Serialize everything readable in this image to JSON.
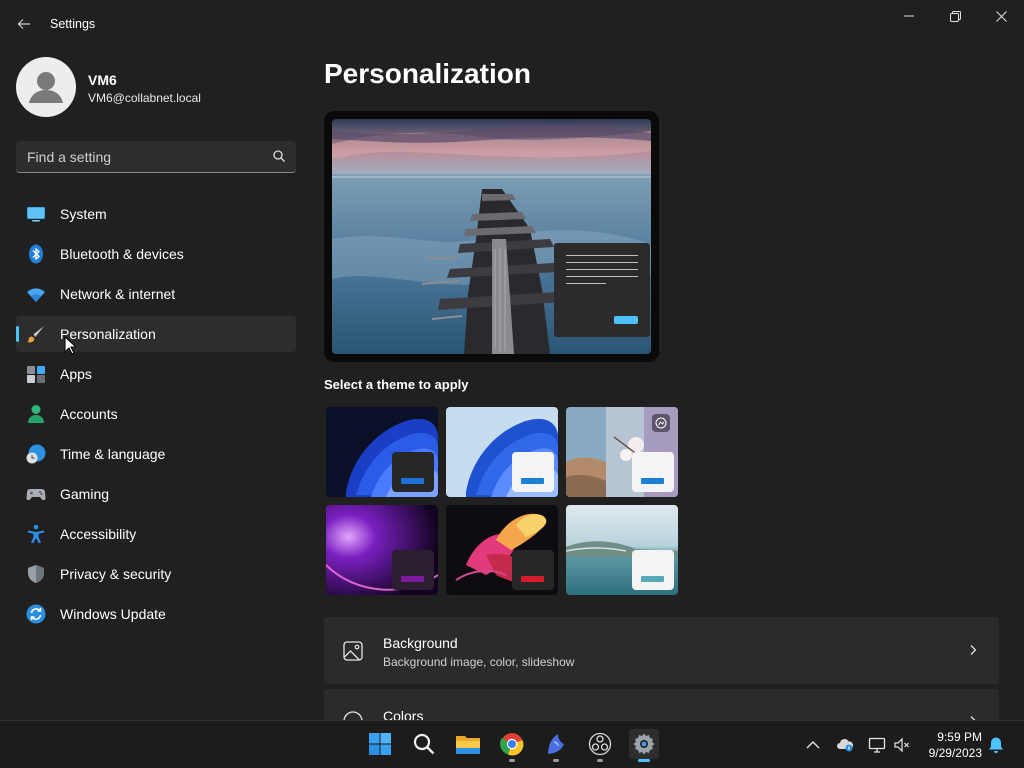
{
  "window": {
    "title": "Settings",
    "back_icon": "back-arrow-icon",
    "controls": [
      "minimize-icon",
      "restore-icon",
      "close-icon"
    ]
  },
  "profile": {
    "name": "VM6",
    "email": "VM6@collabnet.local"
  },
  "search": {
    "placeholder": "Find a setting",
    "value": ""
  },
  "nav": {
    "items": [
      {
        "label": "System",
        "icon": "system-icon"
      },
      {
        "label": "Bluetooth & devices",
        "icon": "bluetooth-icon"
      },
      {
        "label": "Network & internet",
        "icon": "wifi-icon"
      },
      {
        "label": "Personalization",
        "icon": "paintbrush-icon",
        "active": true
      },
      {
        "label": "Apps",
        "icon": "apps-icon"
      },
      {
        "label": "Accounts",
        "icon": "accounts-icon"
      },
      {
        "label": "Time & language",
        "icon": "globe-clock-icon"
      },
      {
        "label": "Gaming",
        "icon": "gamepad-icon"
      },
      {
        "label": "Accessibility",
        "icon": "accessibility-icon"
      },
      {
        "label": "Privacy & security",
        "icon": "shield-icon"
      },
      {
        "label": "Windows Update",
        "icon": "update-icon"
      }
    ]
  },
  "main": {
    "title": "Personalization",
    "themes_label": "Select a theme to apply",
    "themes": [
      {
        "name": "windows-dark",
        "accent": "#1c6fd6"
      },
      {
        "name": "windows-light",
        "accent": "#1c7fd6"
      },
      {
        "name": "windows-spotlight",
        "accent": "#1c7fd6"
      },
      {
        "name": "glow",
        "accent": "#7b1a9a"
      },
      {
        "name": "captured-motion",
        "accent": "#d71d2a"
      },
      {
        "name": "flow",
        "accent": "#56a9b8"
      }
    ],
    "cards": [
      {
        "title": "Background",
        "subtitle": "Background image, color, slideshow",
        "icon": "image-icon"
      },
      {
        "title": "Colors",
        "subtitle": "",
        "icon": "palette-icon"
      }
    ]
  },
  "taskbar": {
    "apps": [
      "start-icon",
      "search-icon",
      "file-explorer-icon",
      "chrome-icon",
      "app-bird-icon",
      "obs-icon",
      "settings-icon"
    ],
    "tray": [
      "chevron-up-icon",
      "onedrive-icon",
      "network-icon",
      "volume-muted-icon",
      "notification-bell-icon"
    ],
    "time": "9:59 PM",
    "date": "9/29/2023"
  },
  "colors": {
    "accent": "#4cc2ff",
    "background": "#202020",
    "card": "#2b2b2b"
  }
}
